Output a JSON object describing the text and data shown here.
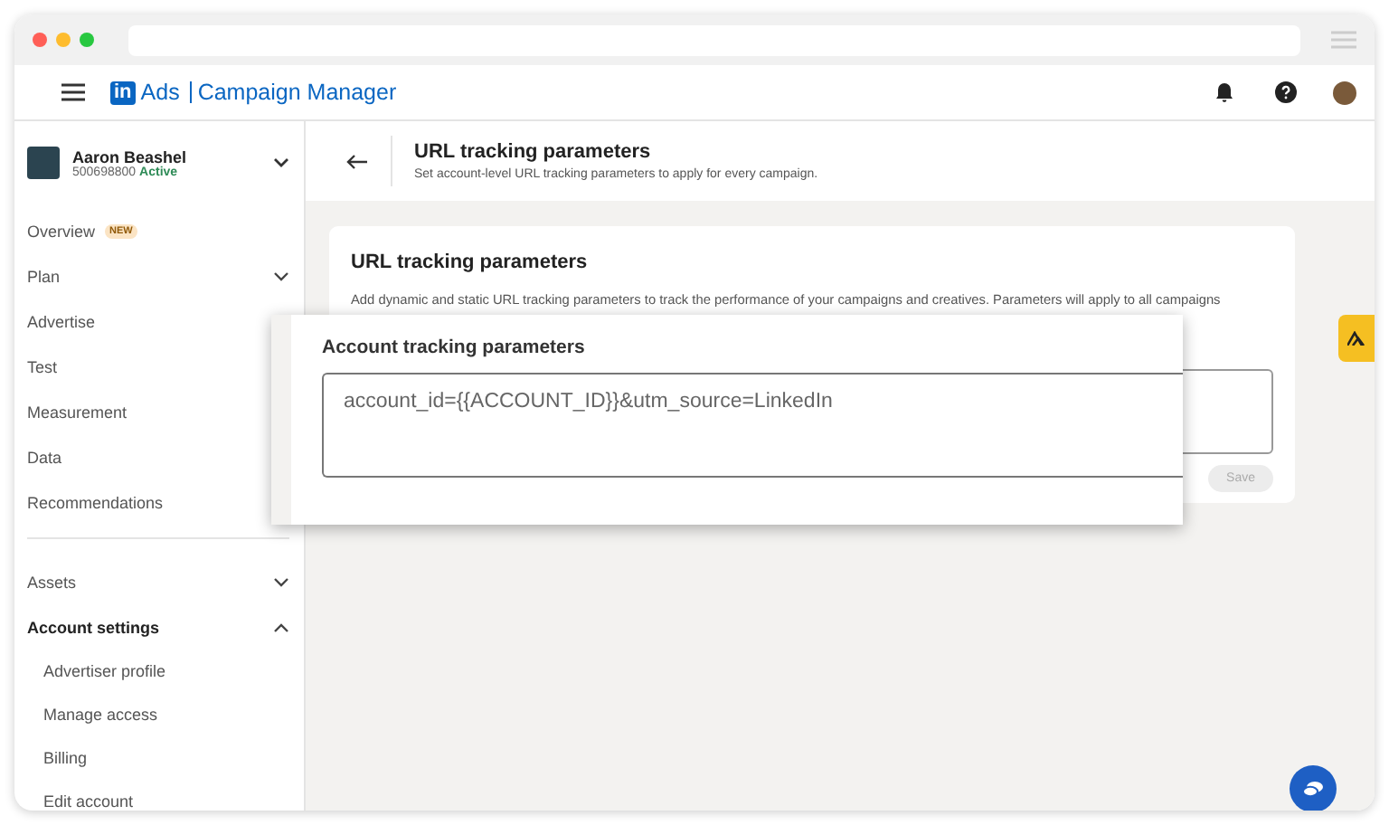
{
  "header": {
    "logo_mark": "in",
    "brand": "Ads",
    "product": "Campaign Manager"
  },
  "account": {
    "name": "Aaron Beashel",
    "id": "500698800",
    "status": "Active"
  },
  "sidebar": {
    "main_items": [
      {
        "label": "Overview",
        "badge": "NEW"
      },
      {
        "label": "Plan",
        "expanded": false
      },
      {
        "label": "Advertise"
      },
      {
        "label": "Test"
      },
      {
        "label": "Measurement"
      },
      {
        "label": "Data"
      },
      {
        "label": "Recommendations"
      }
    ],
    "settings_items": [
      {
        "label": "Assets",
        "expanded": false
      },
      {
        "label": "Account settings",
        "expanded": true,
        "children": [
          {
            "label": "Advertiser profile"
          },
          {
            "label": "Manage access"
          },
          {
            "label": "Billing"
          },
          {
            "label": "Edit account"
          }
        ]
      }
    ]
  },
  "page": {
    "title": "URL tracking parameters",
    "subtitle": "Set account-level URL tracking parameters to apply for every campaign."
  },
  "card": {
    "title": "URL tracking parameters",
    "description": "Add dynamic and static URL tracking parameters to track the performance of your campaigns and creatives. Parameters will apply to all campaigns",
    "save": {
      "label": "Save",
      "disabled": true
    }
  },
  "zoom_callout": {
    "label": "Account tracking parameters",
    "value": "account_id={{ACCOUNT_ID}}&utm_source=LinkedIn"
  }
}
